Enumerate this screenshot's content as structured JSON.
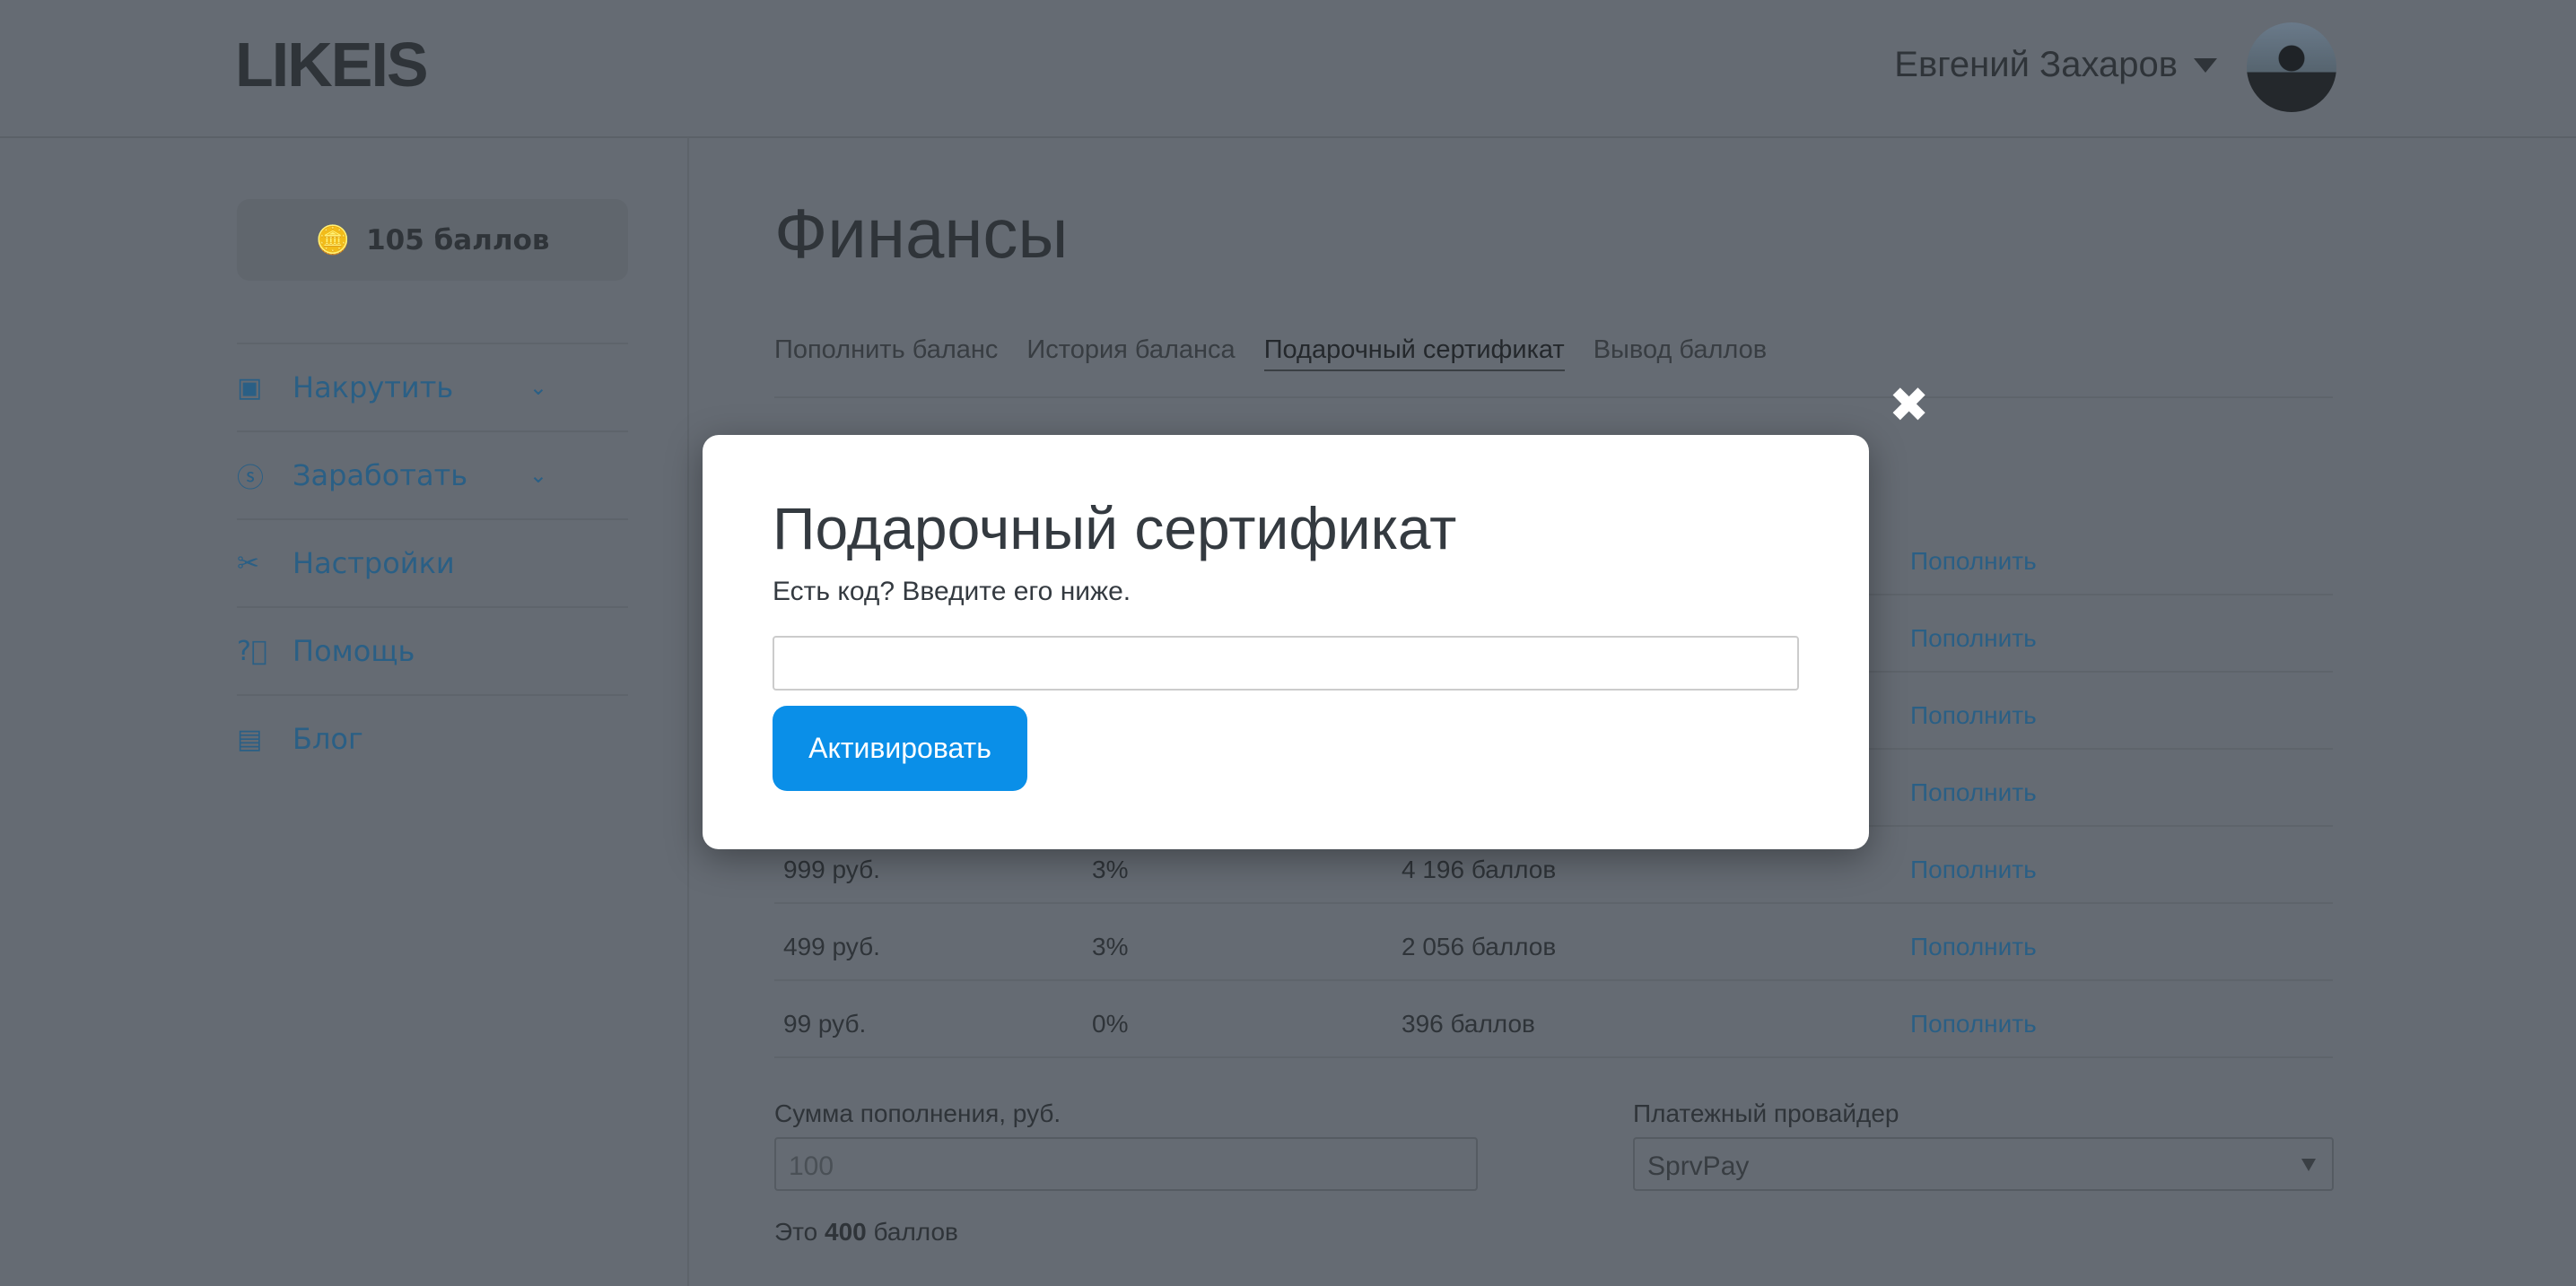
{
  "header": {
    "logo": "LIKEIS",
    "user_name": "Евгений Захаров"
  },
  "sidebar": {
    "balance": "105 баллов",
    "items": [
      {
        "label": "Накрутить",
        "icon": "ad-icon",
        "has_chevron": true
      },
      {
        "label": "Заработать",
        "icon": "dollar-circle-icon",
        "has_chevron": true
      },
      {
        "label": "Настройки",
        "icon": "tools-icon"
      },
      {
        "label": "Помощь",
        "icon": "question-circle-icon"
      },
      {
        "label": "Блог",
        "icon": "book-icon"
      }
    ]
  },
  "main": {
    "title": "Финансы",
    "tabs": [
      "Пополнить баланс",
      "История баланса",
      "Подарочный сертификат",
      "Вывод баллов"
    ],
    "active_tab": "Подарочный сертификат",
    "rows": [
      {
        "price": "",
        "bonus": "",
        "points": "",
        "action": "Пополнить"
      },
      {
        "price": "",
        "bonus": "",
        "points": "",
        "action": "Пополнить"
      },
      {
        "price": "",
        "bonus": "",
        "points": "",
        "action": "Пополнить"
      },
      {
        "price": "",
        "bonus": "",
        "points": "",
        "action": "Пополнить"
      },
      {
        "price": "999 руб.",
        "bonus": "3%",
        "points": "4 196 баллов",
        "action": "Пополнить"
      },
      {
        "price": "499 руб.",
        "bonus": "3%",
        "points": "2 056 баллов",
        "action": "Пополнить"
      },
      {
        "price": "99 руб.",
        "bonus": "0%",
        "points": "396 баллов",
        "action": "Пополнить"
      }
    ],
    "amount_label": "Сумма пополнения, руб.",
    "amount_placeholder": "100",
    "provider_label": "Платежный провайдер",
    "provider_value": "SprvPay",
    "note_prefix": "Это",
    "note_points": "400",
    "note_suffix": "баллов"
  },
  "modal": {
    "title": "Подарочный сертификат",
    "subtitle": "Есть код? Введите его ниже.",
    "code_value": "",
    "button": "Активировать",
    "close": "✖"
  },
  "colors": {
    "accent": "#0a8fe8",
    "link": "#2a7bc0"
  }
}
